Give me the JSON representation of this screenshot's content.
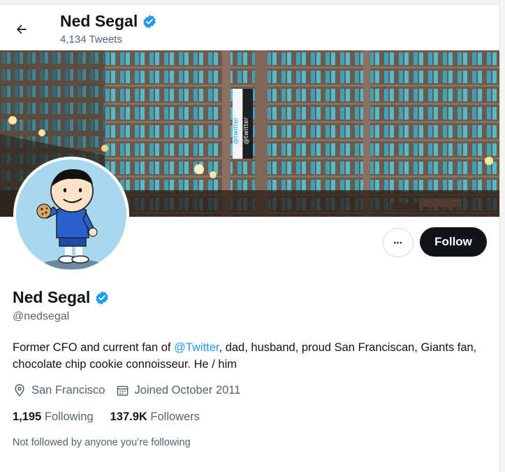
{
  "header": {
    "name": "Ned Segal",
    "tweets": "4,134 Tweets"
  },
  "profile": {
    "name": "Ned Segal",
    "handle": "@nedsegal",
    "bio_part1": "Former CFO and current fan of ",
    "bio_mention": "@Twitter",
    "bio_part2": ", dad, husband, proud San Franciscan, Giants fan, chocolate chip cookie connoisseur. He / him",
    "location": "San Francisco",
    "joined": "Joined October 2011",
    "following_count": "1,195",
    "following_label": "Following",
    "followers_count": "137.9K",
    "followers_label": "Followers",
    "not_followed_text": "Not followed by anyone you’re following"
  },
  "actions": {
    "more_label": "•••",
    "follow_label": "Follow"
  },
  "banner": {
    "sign_text": "@twitter"
  },
  "colors": {
    "verified": "#1d9bf0",
    "follow_bg": "#0f1419",
    "secondary_text": "#536471",
    "link": "#1d9bf0"
  },
  "icons": {
    "back": "arrow-left-icon",
    "verified": "verified-badge-icon",
    "location": "location-pin-icon",
    "calendar": "calendar-icon"
  }
}
